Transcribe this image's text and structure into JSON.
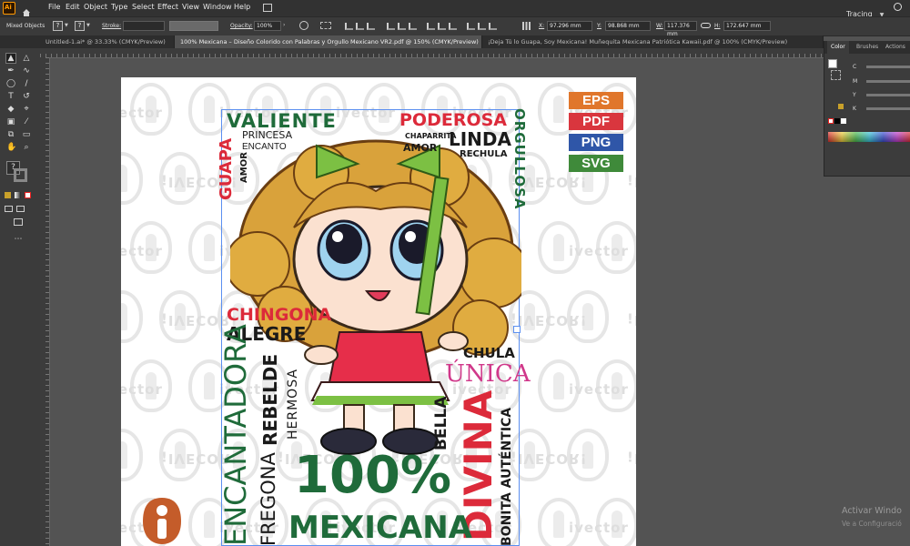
{
  "app": {
    "logo_text": "Ai",
    "workspace": "Tracing"
  },
  "menu": [
    "File",
    "Edit",
    "Object",
    "Type",
    "Select",
    "Effect",
    "View",
    "Window",
    "Help"
  ],
  "control_bar": {
    "selection": "Mixed Objects",
    "stroke_label": "Stroke:",
    "opacity_label": "Opacity:",
    "opacity_value": "100%",
    "x_label": "X:",
    "x_value": "97.296 mm",
    "y_label": "Y:",
    "y_value": "98.868 mm",
    "w_label": "W:",
    "w_value": "117.376 mm",
    "h_label": "H:",
    "h_value": "172.647 mm",
    "question_mark": "?"
  },
  "tabs": [
    {
      "label": "Untitled-1.ai* @ 33.33% (CMYK/Preview)",
      "active": false
    },
    {
      "label": "100% Mexicana – Diseño Colorido con Palabras y Orgullo Mexicano VR2.pdf @ 150% (CMYK/Preview)",
      "active": true
    },
    {
      "label": "¡Deja Tú lo Guapa, Soy Mexicana! Muñequita Mexicana Patriótica Kawaii.pdf @ 100% (CMYK/Preview)",
      "active": false
    }
  ],
  "panel": {
    "tabs": [
      "Color",
      "Brushes",
      "Actions"
    ],
    "channels": [
      "C",
      "M",
      "Y",
      "K"
    ]
  },
  "artwork": {
    "watermark": "ivector",
    "watermark_mirror": "¡IVECOR!",
    "formats": [
      {
        "label": "EPS",
        "color": "#e0762b"
      },
      {
        "label": "PDF",
        "color": "#d9363e"
      },
      {
        "label": "PNG",
        "color": "#2f56a8"
      },
      {
        "label": "SVG",
        "color": "#3f8a3a"
      }
    ],
    "words": {
      "valiente": "VALIENTE",
      "poderosa": "PODEROSA",
      "princesa": "PRINCESA",
      "encanto": "ENCANTO",
      "amor1": "AMOR",
      "guapa": "GUAPA",
      "chaparrita": "CHAPARRITA",
      "amor2": "AMOR",
      "linda": "LINDA",
      "rechula": "RECHULA",
      "orgullosa": "ORGULLOSA",
      "chingona": "CHINGONA",
      "alegre": "ALEGRE",
      "rebelde": "REBELDE",
      "hermosa": "HERMOSA",
      "encantadora": "ENCANTADORA",
      "chula": "CHULA",
      "unica": "ÚNICA",
      "bella": "BELLA",
      "divina": "DIVINA",
      "bonita": "BONITA AUTÉNTICA",
      "cien": "100%",
      "mexicana": "MEXICANA",
      "fregona": "FREGONA"
    }
  },
  "system_overlay": {
    "line1": "Activar Windo",
    "line2": "Ve a Configuració"
  },
  "colors": {
    "green": "#1f6b3a",
    "red": "#dc2a3a",
    "pink": "#d0388a",
    "hair": "#d9a23b",
    "ribbon": "#7cc043"
  }
}
